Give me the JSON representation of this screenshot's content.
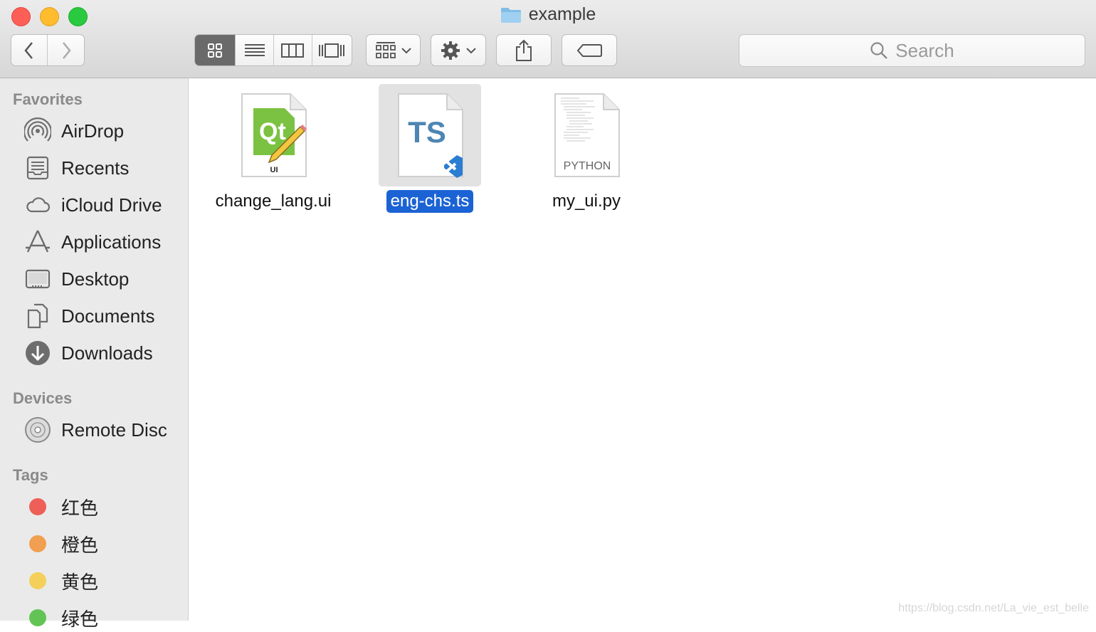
{
  "window": {
    "title": "example",
    "title_icon": "folder-icon"
  },
  "toolbar": {
    "back_icon": "chevron-left-icon",
    "forward_icon": "chevron-right-icon",
    "view_icons": [
      "icon-view-icon",
      "list-view-icon",
      "column-view-icon",
      "cover-flow-icon"
    ],
    "group_icon": "group-by-icon",
    "action_icon": "gear-icon",
    "share_icon": "share-icon",
    "tag_icon": "tag-icon"
  },
  "search": {
    "placeholder": "Search",
    "icon": "magnifier-icon"
  },
  "sidebar": {
    "favorites_label": "Favorites",
    "favorites": [
      {
        "label": "AirDrop",
        "icon": "airdrop-icon"
      },
      {
        "label": "Recents",
        "icon": "recents-icon"
      },
      {
        "label": "iCloud Drive",
        "icon": "cloud-icon"
      },
      {
        "label": "Applications",
        "icon": "applications-icon"
      },
      {
        "label": "Desktop",
        "icon": "desktop-icon"
      },
      {
        "label": "Documents",
        "icon": "documents-icon"
      },
      {
        "label": "Downloads",
        "icon": "downloads-icon"
      }
    ],
    "devices_label": "Devices",
    "devices": [
      {
        "label": "Remote Disc",
        "icon": "disc-icon"
      }
    ],
    "tags_label": "Tags",
    "tags": [
      {
        "label": "红色",
        "color": "#ee5f57"
      },
      {
        "label": "橙色",
        "color": "#f0a050"
      },
      {
        "label": "黄色",
        "color": "#f4d05a"
      },
      {
        "label": "绿色",
        "color": "#62c454"
      }
    ]
  },
  "files": [
    {
      "name": "change_lang.ui",
      "icon": "qt-designer-file-icon",
      "badge": "Qt",
      "sub": "UI",
      "selected": false
    },
    {
      "name": "eng-chs.ts",
      "icon": "typescript-file-icon",
      "badge": "TS",
      "selected": true
    },
    {
      "name": "my_ui.py",
      "icon": "python-file-icon",
      "badge": "PYTHON",
      "selected": false
    }
  ],
  "watermark": "https://blog.csdn.net/La_vie_est_belle",
  "colors": {
    "selection": "#1b63d4",
    "close": "#fd5f57",
    "minimize": "#febc2e",
    "zoom": "#29c940"
  }
}
